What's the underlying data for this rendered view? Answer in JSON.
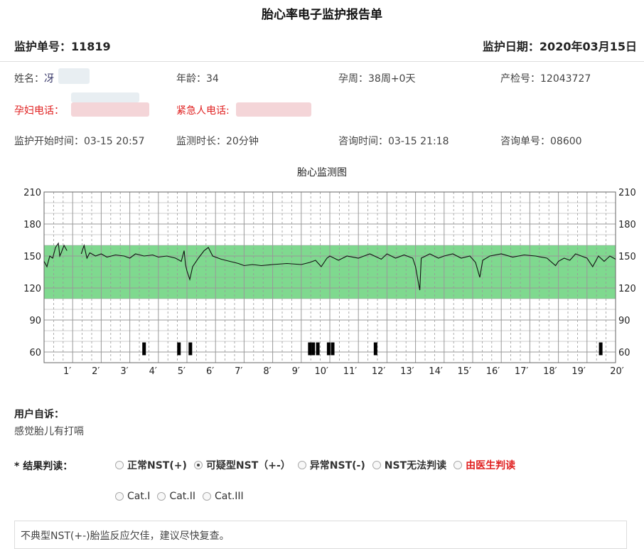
{
  "title": "胎心率电子监护报告单",
  "header": {
    "order_no": "监护单号：11819",
    "monitor_date": "监护日期：2020年03月15日"
  },
  "info": {
    "name_label": "姓名：",
    "name_value": "冴",
    "age": "年龄：34",
    "gestation": "孕周：38周+0天",
    "checkup_no": "产检号：12043727",
    "phone_label": "孕妇电话：",
    "emergency_label": "紧急人电话:",
    "start_time": "监护开始时间：03-15 20:57",
    "duration": "监测时长：20分钟",
    "consult_time": "咨询时间：03-15 21:18",
    "consult_no": "咨询单号：08600"
  },
  "colors": {
    "band": "#7fd98f",
    "grid": "#999999",
    "trace": "#111111",
    "alert_red": "#e02020"
  },
  "chart_data": {
    "type": "line",
    "title": "胎心监测图",
    "xlabel": "",
    "ylabel": "",
    "x_unit": "minutes",
    "xlim": [
      0,
      20
    ],
    "ylim": [
      50,
      210
    ],
    "y_ticks": [
      60,
      90,
      120,
      150,
      180,
      210
    ],
    "x_tick_labels": [
      "1′",
      "2′",
      "3′",
      "4′",
      "5′",
      "6′",
      "7′",
      "8′",
      "9′",
      "10′",
      "11′",
      "12′",
      "13′",
      "14′",
      "15′",
      "16′",
      "17′",
      "18′",
      "19′",
      "20′"
    ],
    "normal_band": [
      110,
      160
    ],
    "grid": true,
    "series": [
      {
        "values": [
          [
            0.0,
            145
          ],
          [
            0.1,
            140
          ],
          [
            0.2,
            150
          ],
          [
            0.3,
            148
          ],
          [
            0.4,
            158
          ],
          [
            0.5,
            162
          ],
          [
            0.55,
            150
          ],
          [
            0.6,
            153
          ],
          [
            0.7,
            160
          ],
          [
            0.8,
            155
          ],
          [
            1.0,
            null
          ],
          [
            1.3,
            152
          ],
          [
            1.4,
            160
          ],
          [
            1.5,
            148
          ],
          [
            1.6,
            153
          ],
          [
            1.8,
            150
          ],
          [
            2.0,
            152
          ],
          [
            2.2,
            149
          ],
          [
            2.5,
            151
          ],
          [
            2.8,
            150
          ],
          [
            3.0,
            148
          ],
          [
            3.2,
            152
          ],
          [
            3.5,
            150
          ],
          [
            3.8,
            151
          ],
          [
            4.0,
            149
          ],
          [
            4.3,
            150
          ],
          [
            4.6,
            148
          ],
          [
            4.8,
            145
          ],
          [
            4.9,
            155
          ],
          [
            4.95,
            142
          ],
          [
            5.0,
            136
          ],
          [
            5.1,
            128
          ],
          [
            5.2,
            140
          ],
          [
            5.4,
            148
          ],
          [
            5.6,
            155
          ],
          [
            5.75,
            158
          ],
          [
            5.9,
            150
          ],
          [
            6.2,
            147
          ],
          [
            6.5,
            145
          ],
          [
            6.8,
            143
          ],
          [
            7.0,
            141
          ],
          [
            7.3,
            142
          ],
          [
            7.6,
            141
          ],
          [
            8.0,
            142
          ],
          [
            8.5,
            143
          ],
          [
            9.0,
            142
          ],
          [
            9.3,
            144
          ],
          [
            9.5,
            146
          ],
          [
            9.7,
            140
          ],
          [
            9.9,
            148
          ],
          [
            10.0,
            150
          ],
          [
            10.3,
            146
          ],
          [
            10.6,
            150
          ],
          [
            11.0,
            148
          ],
          [
            11.4,
            152
          ],
          [
            11.8,
            147
          ],
          [
            12.0,
            152
          ],
          [
            12.3,
            148
          ],
          [
            12.6,
            151
          ],
          [
            12.9,
            148
          ],
          [
            13.0,
            140
          ],
          [
            13.1,
            125
          ],
          [
            13.15,
            118
          ],
          [
            13.2,
            148
          ],
          [
            13.5,
            152
          ],
          [
            13.8,
            148
          ],
          [
            14.0,
            150
          ],
          [
            14.3,
            152
          ],
          [
            14.6,
            148
          ],
          [
            14.9,
            150
          ],
          [
            15.1,
            144
          ],
          [
            15.25,
            130
          ],
          [
            15.35,
            146
          ],
          [
            15.6,
            150
          ],
          [
            16.0,
            152
          ],
          [
            16.4,
            149
          ],
          [
            16.8,
            151
          ],
          [
            17.2,
            150
          ],
          [
            17.6,
            148
          ],
          [
            17.9,
            141
          ],
          [
            18.0,
            145
          ],
          [
            18.2,
            148
          ],
          [
            18.4,
            146
          ],
          [
            18.6,
            152
          ],
          [
            18.8,
            150
          ],
          [
            19.0,
            148
          ],
          [
            19.2,
            140
          ],
          [
            19.4,
            150
          ],
          [
            19.6,
            145
          ],
          [
            19.8,
            150
          ],
          [
            20.0,
            147
          ]
        ]
      }
    ],
    "movement_marks_min": [
      3.5,
      4.72,
      5.12,
      9.3,
      9.42,
      9.58,
      9.96,
      10.1,
      11.6,
      19.48
    ]
  },
  "complaint": {
    "label": "用户自诉：",
    "text": "感觉胎儿有打嗝"
  },
  "result": {
    "label": "* 结果判读：",
    "options": [
      "正常NST(+)",
      "可疑型NST（+-）",
      "异常NST(-)",
      "NST无法判读",
      "由医生判读"
    ],
    "selected": "可疑型NST（+-）",
    "cat_options": [
      "Cat.I",
      "Cat.II",
      "Cat.III"
    ],
    "note": "不典型NST(+-)胎监反应欠佳，建议尽快复查。"
  }
}
